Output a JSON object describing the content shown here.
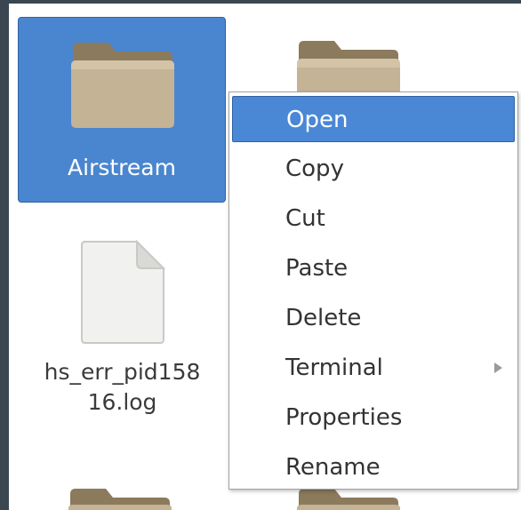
{
  "files": [
    {
      "name": "Airstream",
      "type": "folder",
      "selected": true
    },
    {
      "name": "",
      "type": "folder"
    },
    {
      "name_line1": "hs_err_pid158",
      "name_line2": "16.log",
      "type": "file"
    }
  ],
  "context_menu": {
    "items": [
      {
        "label": "Open",
        "active": true
      },
      {
        "label": "Copy"
      },
      {
        "label": "Cut"
      },
      {
        "label": "Paste"
      },
      {
        "label": "Delete"
      },
      {
        "label": "Terminal",
        "has_submenu": true
      },
      {
        "label": "Properties"
      },
      {
        "label": "Rename"
      }
    ]
  },
  "colors": {
    "selection": "#4a86cf",
    "menu_highlight": "#4a88d6",
    "folder": "#b9a98c",
    "background": "#3a4750"
  }
}
